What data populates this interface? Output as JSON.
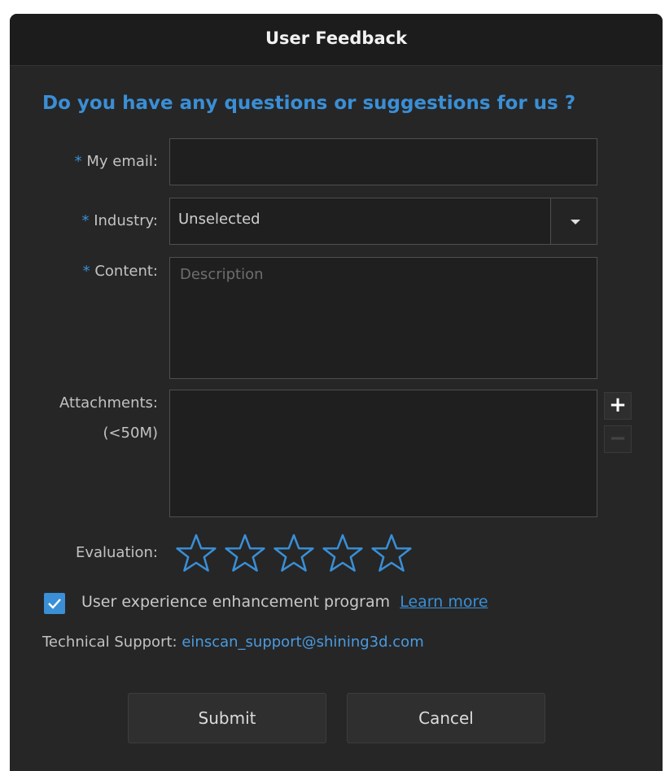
{
  "dialog": {
    "title": "User Feedback",
    "heading": "Do you have any questions or suggestions for us ?"
  },
  "form": {
    "required_marker": "*",
    "email": {
      "label": "My email:",
      "value": "",
      "placeholder": ""
    },
    "industry": {
      "label": "Industry:",
      "value": "Unselected"
    },
    "content": {
      "label": "Content:",
      "value": "",
      "placeholder": "Description"
    },
    "attachments": {
      "label": "Attachments:",
      "sublabel": "(<50M)",
      "add": "+",
      "remove": "−"
    },
    "evaluation": {
      "label": "Evaluation:",
      "rating": 0,
      "max": 5
    }
  },
  "ux_program": {
    "checked": true,
    "label": "User experience enhancement program",
    "link": "Learn more "
  },
  "support": {
    "label": "Technical Support:",
    "email": "einscan_support@shining3d.com"
  },
  "buttons": {
    "submit": "Submit",
    "cancel": "Cancel"
  },
  "colors": {
    "accent": "#3a8fd6",
    "background": "#262626",
    "titlebar": "#1c1c1c"
  },
  "icons": [
    "chevron-down-icon",
    "plus-icon",
    "minus-icon",
    "star-outline-icon",
    "checkmark-icon"
  ]
}
